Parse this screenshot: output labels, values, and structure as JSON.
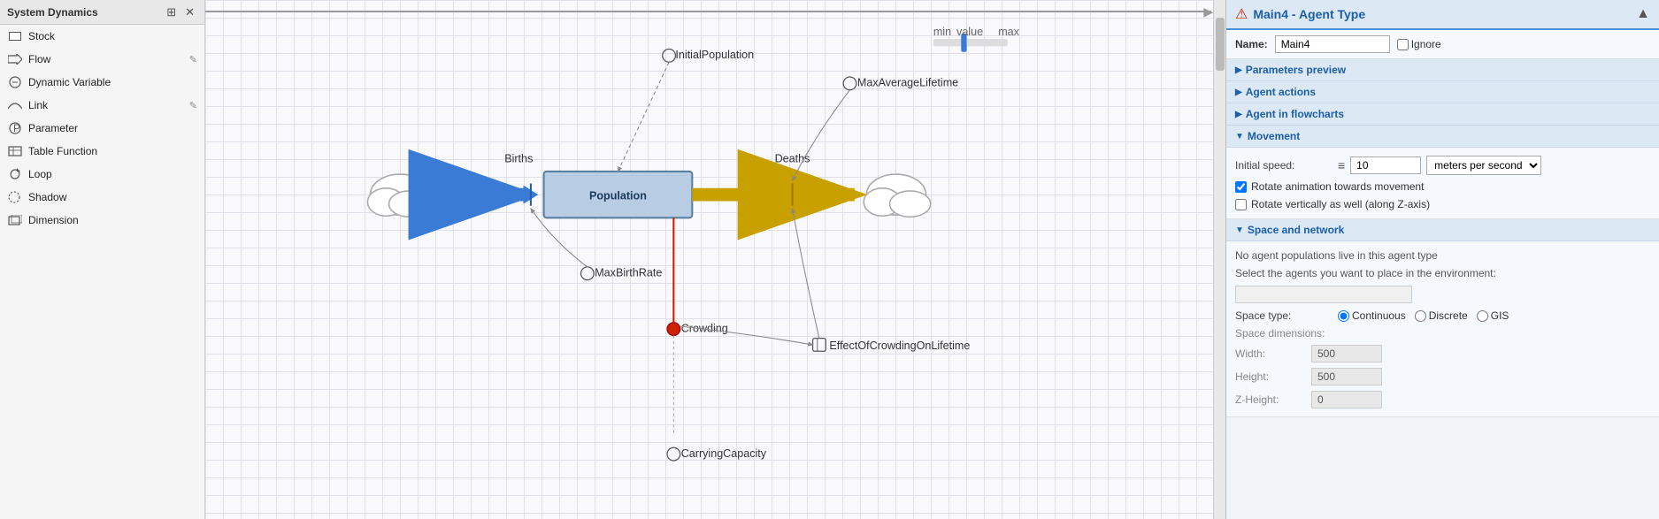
{
  "sidebar": {
    "title": "System Dynamics",
    "items": [
      {
        "id": "stock",
        "label": "Stock",
        "icon": "stock-icon",
        "editable": false
      },
      {
        "id": "flow",
        "label": "Flow",
        "icon": "flow-icon",
        "editable": true
      },
      {
        "id": "dynamic-variable",
        "label": "Dynamic Variable",
        "icon": "dynvar-icon",
        "editable": false
      },
      {
        "id": "link",
        "label": "Link",
        "icon": "link-icon",
        "editable": true
      },
      {
        "id": "parameter",
        "label": "Parameter",
        "icon": "param-icon",
        "editable": false
      },
      {
        "id": "table-function",
        "label": "Table Function",
        "icon": "table-icon",
        "editable": false
      },
      {
        "id": "loop",
        "label": "Loop",
        "icon": "loop-icon",
        "editable": false
      },
      {
        "id": "shadow",
        "label": "Shadow",
        "icon": "shadow-icon",
        "editable": false
      },
      {
        "id": "dimension",
        "label": "Dimension",
        "icon": "dimension-icon",
        "editable": false
      }
    ]
  },
  "right_panel": {
    "title": "Main4 - Agent Type",
    "error_icon": "⚠",
    "name_label": "Name:",
    "name_value": "Main4",
    "ignore_label": "Ignore",
    "sections": {
      "parameters_preview": {
        "label": "Parameters preview",
        "expanded": false
      },
      "agent_actions": {
        "label": "Agent actions",
        "expanded": false
      },
      "agent_in_flowcharts": {
        "label": "Agent in flowcharts",
        "expanded": false
      },
      "movement": {
        "label": "Movement",
        "expanded": true,
        "initial_speed_label": "Initial speed:",
        "initial_speed_value": "10",
        "initial_speed_unit": "meters per second",
        "rotate_animation_label": "Rotate animation towards movement",
        "rotate_animation_checked": true,
        "rotate_vertically_label": "Rotate vertically as well (along Z-axis)",
        "rotate_vertically_checked": false
      },
      "space_and_network": {
        "label": "Space and network",
        "expanded": true,
        "no_populations_text": "No agent populations live in this agent type",
        "select_agents_text": "Select the agents you want to place in the environment:",
        "space_type_label": "Space type:",
        "space_type_options": [
          "Continuous",
          "Discrete",
          "GIS"
        ],
        "space_type_selected": "Continuous",
        "space_dimensions_label": "Space dimensions:",
        "width_label": "Width:",
        "width_value": "500",
        "height_label": "Height:",
        "height_value": "500",
        "z_height_label": "Z-Height:",
        "z_height_value": "0"
      }
    }
  },
  "diagram": {
    "nodes": {
      "initialpopulation": "InitialPopulation",
      "maxaveragelifetime": "MaxAverageLifetime",
      "population": "Population",
      "births": "Births",
      "deaths": "Deaths",
      "maxbirthrate": "MaxBirthRate",
      "crowding": "Crowding",
      "effectofcrowdingonlifetime": "EffectOfCrowdingOnLifetime",
      "carryingcapacity": "CarryingCapacity"
    }
  }
}
